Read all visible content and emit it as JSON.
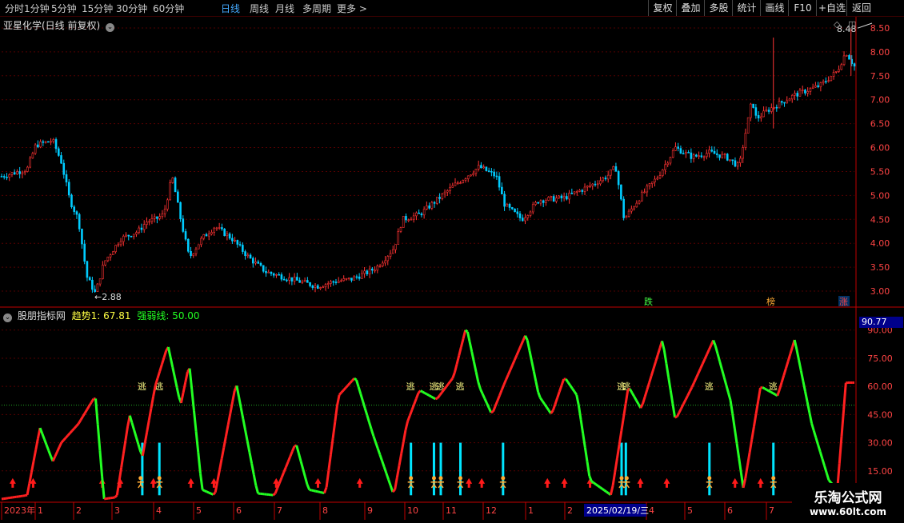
{
  "toolbar": {
    "periods": [
      "分时",
      "1分钟",
      "5分钟",
      "15分钟",
      "30分钟",
      "60分钟",
      "日线",
      "周线",
      "月线",
      "多周期",
      "更多"
    ],
    "active_period": "日线",
    "right_buttons": [
      "复权",
      "叠加",
      "多股",
      "统计",
      "画线",
      "F10",
      "+自选",
      "返回"
    ]
  },
  "main_panel": {
    "title": "亚星化学(日线 前复权)",
    "max_label": "8.48",
    "min_label": "2.88",
    "signals": [
      "跌",
      "榜",
      "涨"
    ]
  },
  "indicator_panel": {
    "title": "股朋指标网",
    "trend_label": "趋势1: 67.81",
    "strength_label": "强弱线: 50.00",
    "current_value_box": "90.77",
    "escape_label": "逃"
  },
  "xaxis": {
    "labels": [
      "2023年",
      "1",
      "2",
      "3",
      "4",
      "5",
      "6",
      "7",
      "8",
      "9",
      "10",
      "11",
      "12",
      "1",
      "2",
      "4",
      "5",
      "6",
      "7"
    ],
    "cursor_date": "2025/02/19/三"
  },
  "watermark": {
    "title": "乐淘公式网",
    "url": "www.60lt.com"
  },
  "colors": {
    "up": "#ff3333",
    "down": "#00ccff",
    "trend_up": "#ff2020",
    "trend_down": "#22ff22",
    "grid": "#550000",
    "axis": "#c00000",
    "signal_bar": "#00e5ff",
    "arrow": "#ff1a1a",
    "person": "#ffaa33"
  },
  "chart_data": [
    {
      "type": "candlestick",
      "title": "亚星化学(日线 前复权)",
      "yaxis_ticks": [
        "8.50",
        "8.00",
        "7.50",
        "7.00",
        "6.50",
        "6.00",
        "5.50",
        "5.00",
        "4.50",
        "4.00",
        "3.50",
        "3.00"
      ],
      "ylim": [
        2.75,
        8.6
      ],
      "max": 8.48,
      "min": 2.88,
      "close_trace": [
        [
          0,
          5.4
        ],
        [
          0.03,
          5.55
        ],
        [
          0.04,
          6.05
        ],
        [
          0.06,
          6.15
        ],
        [
          0.07,
          5.7
        ],
        [
          0.08,
          4.9
        ],
        [
          0.09,
          4.5
        ],
        [
          0.1,
          3.3
        ],
        [
          0.11,
          2.95
        ],
        [
          0.12,
          3.6
        ],
        [
          0.14,
          4.1
        ],
        [
          0.16,
          4.25
        ],
        [
          0.17,
          4.45
        ],
        [
          0.18,
          4.5
        ],
        [
          0.19,
          4.6
        ],
        [
          0.2,
          5.4
        ],
        [
          0.21,
          4.5
        ],
        [
          0.22,
          3.7
        ],
        [
          0.235,
          4.1
        ],
        [
          0.25,
          4.35
        ],
        [
          0.27,
          4.1
        ],
        [
          0.29,
          3.7
        ],
        [
          0.31,
          3.4
        ],
        [
          0.33,
          3.3
        ],
        [
          0.35,
          3.2
        ],
        [
          0.37,
          3.1
        ],
        [
          0.39,
          3.2
        ],
        [
          0.41,
          3.25
        ],
        [
          0.43,
          3.4
        ],
        [
          0.44,
          3.5
        ],
        [
          0.46,
          3.9
        ],
        [
          0.47,
          4.5
        ],
        [
          0.49,
          4.6
        ],
        [
          0.51,
          4.9
        ],
        [
          0.53,
          5.2
        ],
        [
          0.56,
          5.6
        ],
        [
          0.58,
          5.4
        ],
        [
          0.59,
          4.8
        ],
        [
          0.61,
          4.5
        ],
        [
          0.63,
          4.9
        ],
        [
          0.66,
          4.95
        ],
        [
          0.69,
          5.2
        ],
        [
          0.71,
          5.4
        ],
        [
          0.72,
          5.6
        ],
        [
          0.73,
          4.5
        ],
        [
          0.75,
          5.0
        ],
        [
          0.77,
          5.4
        ],
        [
          0.79,
          6.0
        ],
        [
          0.81,
          5.8
        ],
        [
          0.83,
          5.9
        ],
        [
          0.85,
          5.8
        ],
        [
          0.865,
          5.6
        ],
        [
          0.87,
          6.1
        ],
        [
          0.88,
          7.0
        ],
        [
          0.885,
          6.6
        ],
        [
          0.9,
          6.8
        ],
        [
          0.93,
          7.1
        ],
        [
          0.96,
          7.3
        ],
        [
          0.98,
          7.6
        ],
        [
          0.99,
          8.0
        ],
        [
          1,
          7.7
        ]
      ]
    },
    {
      "type": "line",
      "title": "股朋指标网",
      "yaxis_ticks": [
        "90.00",
        "75.00",
        "60.00",
        "45.00",
        "30.00",
        "15.00"
      ],
      "ylim": [
        0,
        95
      ],
      "series": [
        {
          "name": "趋势1",
          "last": 67.81,
          "values": [
            [
              0,
              0
            ],
            [
              0.03,
              2
            ],
            [
              0.045,
              38
            ],
            [
              0.06,
              20
            ],
            [
              0.07,
              30
            ],
            [
              0.09,
              40
            ],
            [
              0.11,
              55
            ],
            [
              0.12,
              0
            ],
            [
              0.135,
              1
            ],
            [
              0.15,
              45
            ],
            [
              0.165,
              22
            ],
            [
              0.18,
              60
            ],
            [
              0.195,
              82
            ],
            [
              0.21,
              50
            ],
            [
              0.22,
              72
            ],
            [
              0.235,
              5
            ],
            [
              0.25,
              2
            ],
            [
              0.275,
              62
            ],
            [
              0.3,
              3
            ],
            [
              0.32,
              2
            ],
            [
              0.345,
              30
            ],
            [
              0.36,
              5
            ],
            [
              0.38,
              3
            ],
            [
              0.395,
              55
            ],
            [
              0.415,
              65
            ],
            [
              0.435,
              35
            ],
            [
              0.46,
              2
            ],
            [
              0.475,
              40
            ],
            [
              0.49,
              58
            ],
            [
              0.51,
              53
            ],
            [
              0.53,
              65
            ],
            [
              0.545,
              92
            ],
            [
              0.56,
              60
            ],
            [
              0.575,
              45
            ],
            [
              0.59,
              62
            ],
            [
              0.615,
              88
            ],
            [
              0.63,
              55
            ],
            [
              0.645,
              45
            ],
            [
              0.66,
              65
            ],
            [
              0.675,
              55
            ],
            [
              0.69,
              10
            ],
            [
              0.715,
              2
            ],
            [
              0.735,
              60
            ],
            [
              0.75,
              48
            ],
            [
              0.775,
              85
            ],
            [
              0.79,
              42
            ],
            [
              0.81,
              60
            ],
            [
              0.835,
              85
            ],
            [
              0.855,
              52
            ],
            [
              0.87,
              5
            ],
            [
              0.89,
              60
            ],
            [
              0.91,
              55
            ],
            [
              0.93,
              85
            ],
            [
              0.95,
              40
            ],
            [
              0.97,
              10
            ],
            [
              0.98,
              5
            ],
            [
              0.99,
              62
            ],
            [
              1,
              62
            ]
          ]
        },
        {
          "name": "强弱线",
          "last": 50.0
        }
      ]
    }
  ]
}
